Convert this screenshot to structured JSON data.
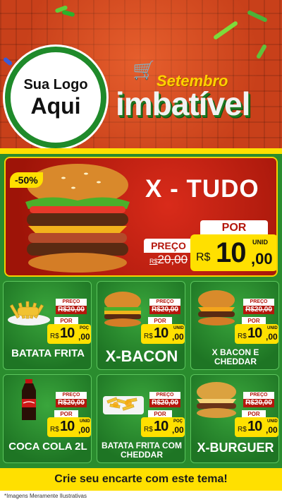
{
  "header": {
    "logo_line1": "Sua Logo",
    "logo_line2": "Aqui",
    "brand_top": "Setembro",
    "brand_bottom": "imbatível",
    "cart_icon": "shopping-cart-icon"
  },
  "hero": {
    "discount": "-50%",
    "title": "X - TUDO",
    "preco_label": "PREÇO",
    "old_price_rs": "R$",
    "old_price": "20,00",
    "por_label": "POR",
    "currency": "R$",
    "price_int": "10",
    "price_cents": ",00",
    "unit": "UNID"
  },
  "cards": [
    {
      "name": "BATATA FRITA",
      "preco_label": "PREÇO",
      "old_price": "R$20,00",
      "por_label": "POR",
      "currency": "R$",
      "price_int": "10",
      "price_cents": ",00",
      "unit": "POÇ"
    },
    {
      "name": "X-BACON",
      "preco_label": "PREÇO",
      "old_price": "R$20,00",
      "por_label": "POR",
      "currency": "R$",
      "price_int": "10",
      "price_cents": ",00",
      "unit": "UNID"
    },
    {
      "name": "X BACON E CHEDDAR",
      "preco_label": "PREÇO",
      "old_price": "R$20,00",
      "por_label": "POR",
      "currency": "R$",
      "price_int": "10",
      "price_cents": ",00",
      "unit": "UNID"
    },
    {
      "name": "COCA COLA 2L",
      "preco_label": "PREÇO",
      "old_price": "R$20,00",
      "por_label": "POR",
      "currency": "R$",
      "price_int": "10",
      "price_cents": ",00",
      "unit": "UNID"
    },
    {
      "name": "BATATA FRITA COM CHEDDAR",
      "preco_label": "PREÇO",
      "old_price": "R$20,00",
      "por_label": "POR",
      "currency": "R$",
      "price_int": "10",
      "price_cents": ",00",
      "unit": "POÇ"
    },
    {
      "name": "X-BURGUER",
      "preco_label": "PREÇO",
      "old_price": "R$20,00",
      "por_label": "POR",
      "currency": "R$",
      "price_int": "10",
      "price_cents": ",00",
      "unit": "UNID"
    }
  ],
  "footer": {
    "cta": "Crie seu encarte com este tema!",
    "disclaimer": "*Imagens Meramente Ilustrativas"
  },
  "colors": {
    "header_red": "#c8401a",
    "brand_green": "#2a8c2e",
    "accent_yellow": "#ffe000",
    "price_red": "#b4170c"
  }
}
